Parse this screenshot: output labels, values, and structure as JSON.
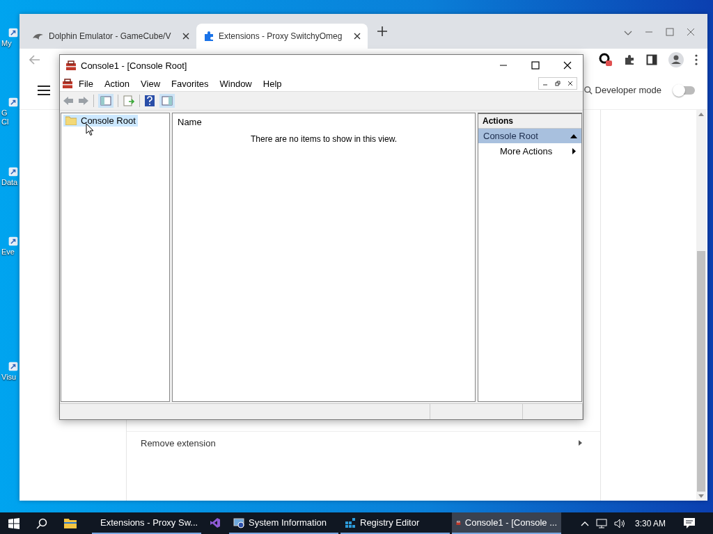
{
  "desktop_icons": [
    {
      "label_lines": [
        "My"
      ]
    },
    {
      "label_lines": [
        "G",
        "Cl"
      ]
    },
    {
      "label_lines": [
        "Data"
      ]
    },
    {
      "label_lines": [
        "Eve"
      ]
    },
    {
      "label_lines": [
        "Visu"
      ]
    }
  ],
  "browser": {
    "tabs": [
      {
        "title": "Dolphin Emulator - GameCube/V",
        "selected": false
      },
      {
        "title": "Extensions - Proxy SwitchyOmeg",
        "selected": true
      }
    ],
    "developer_mode": {
      "label": "Developer mode",
      "on": false
    },
    "rows": [
      {
        "label": "Remove extension"
      }
    ]
  },
  "console": {
    "title": "Console1 - [Console Root]",
    "menu": [
      "File",
      "Action",
      "View",
      "Favorites",
      "Window",
      "Help"
    ],
    "tree": [
      {
        "label": "Console Root",
        "selected": true
      }
    ],
    "list": {
      "columns": [
        "Name"
      ],
      "empty_message": "There are no items to show in this view."
    },
    "actions": {
      "header": "Actions",
      "groups": [
        {
          "title": "Console Root",
          "expanded": true,
          "items": [
            "More Actions"
          ]
        }
      ]
    }
  },
  "taskbar": {
    "items": [
      {
        "kind": "chrome",
        "label": "Extensions - Proxy Sw...",
        "selected": false
      },
      {
        "kind": "studio",
        "selected": false
      },
      {
        "kind": "sysinfo",
        "label": "System Information",
        "selected": false
      },
      {
        "kind": "registry",
        "label": "Registry Editor",
        "selected": false
      },
      {
        "kind": "console",
        "label": "Console1 - [Console ...",
        "selected": true
      }
    ],
    "clock": "3:30 AM"
  }
}
